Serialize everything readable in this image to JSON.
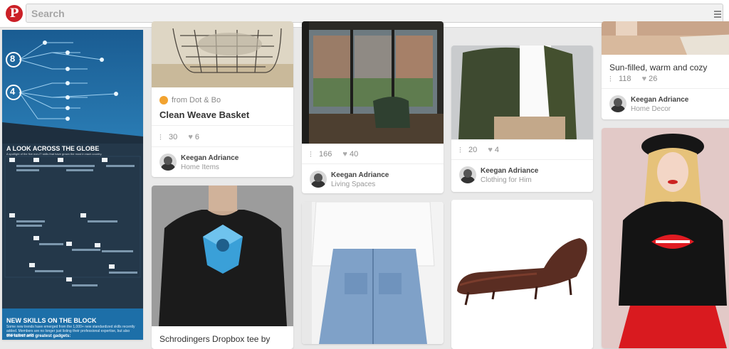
{
  "search": {
    "placeholder": "Search"
  },
  "pins": [
    {
      "source": "from Dot & Bo",
      "title": "Clean Weave Basket",
      "repins": "30",
      "likes": "6",
      "user": "Keegan Adriance",
      "board": "Home Items"
    },
    {
      "repins": "166",
      "likes": "40",
      "user": "Keegan Adriance",
      "board": "Living Spaces"
    },
    {
      "repins": "20",
      "likes": "4",
      "user": "Keegan Adriance",
      "board": "Clothing for Him"
    },
    {
      "title": "Sun-filled, warm and cozy",
      "repins": "118",
      "likes": "26",
      "user": "Keegan Adriance",
      "board": "Home Decor"
    },
    {
      "title": "Schrodingers Dropbox tee by"
    }
  ],
  "infographic": {
    "heading1": "A LOOK ACROSS THE GLOBE",
    "sub1": "A spotlight of the five non-IT skills that have grown the most in each country.",
    "countries": [
      "US",
      "CANADA",
      "FRANCE",
      "RUSSIA",
      "UK",
      "NETHERLANDS",
      "CHINA",
      "MEXICO",
      "TURKEY",
      "JAPAN",
      "BRAZIL",
      "ITALY",
      "INDIA",
      "ARGENTINA",
      "SPAIN",
      "AUSTRALIA",
      "GERMANY"
    ],
    "bubble1": "8",
    "bubble2": "4",
    "heading2": "NEW SKILLS ON THE BLOCK",
    "sub2": "Some new trends have emerged from the 1,000+ new standardized skills recently added. Members are no longer just listing their professional expertise, but also adding them with",
    "sub2b": "the latest and greatest gadgets:"
  },
  "colors": {
    "brand": "#cb2027",
    "infographic_top": "#1e5a8a",
    "infographic_mid": "#24384a"
  }
}
